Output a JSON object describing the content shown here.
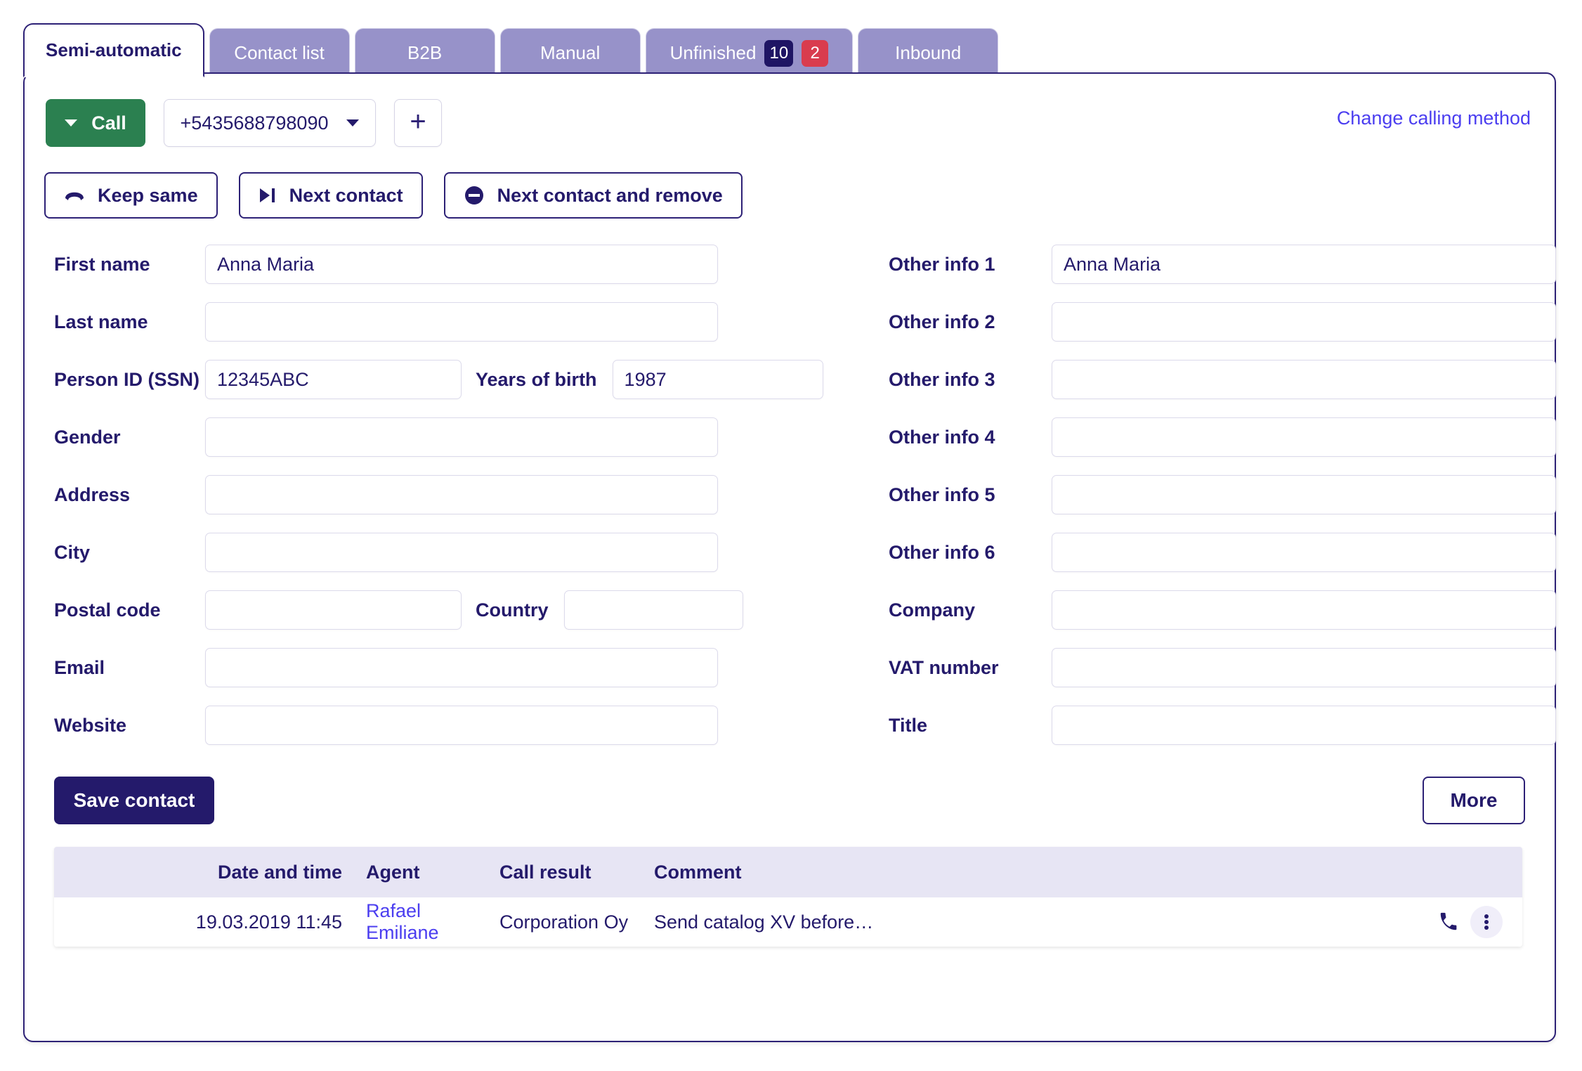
{
  "tabs": [
    {
      "label": "Semi-automatic",
      "active": true,
      "badges": []
    },
    {
      "label": "Contact list",
      "active": false,
      "badges": []
    },
    {
      "label": "B2B",
      "active": false,
      "badges": []
    },
    {
      "label": "Manual",
      "active": false,
      "badges": []
    },
    {
      "label": "Unfinished",
      "active": false,
      "badges": [
        {
          "value": "10",
          "color": "navy"
        },
        {
          "value": "2",
          "color": "red"
        }
      ]
    },
    {
      "label": "Inbound",
      "active": false,
      "badges": []
    }
  ],
  "toolbar": {
    "call_label": "Call",
    "phone_number": "+5435688798090",
    "add_number_label": "+",
    "change_calling_method": "Change calling method",
    "keep_same_label": "Keep same",
    "next_contact_label": "Next contact",
    "next_contact_remove_label": "Next contact and remove"
  },
  "form": {
    "left": {
      "first_name_label": "First name",
      "first_name_value": "Anna Maria",
      "last_name_label": "Last name",
      "last_name_value": "",
      "person_id_label": "Person ID (SSN)",
      "person_id_value": "12345ABC",
      "years_of_birth_label": "Years of birth",
      "years_of_birth_value": "1987",
      "gender_label": "Gender",
      "gender_value": "",
      "address_label": "Address",
      "address_value": "",
      "city_label": "City",
      "city_value": "",
      "postal_code_label": "Postal code",
      "postal_code_value": "",
      "country_label": "Country",
      "country_value": "",
      "email_label": "Email",
      "email_value": "",
      "website_label": "Website",
      "website_value": ""
    },
    "right": {
      "other_info_1_label": "Other info 1",
      "other_info_1_value": "Anna Maria",
      "other_info_2_label": "Other info 2",
      "other_info_2_value": "",
      "other_info_3_label": "Other info 3",
      "other_info_3_value": "",
      "other_info_4_label": "Other info 4",
      "other_info_4_value": "",
      "other_info_5_label": "Other info 5",
      "other_info_5_value": "",
      "other_info_6_label": "Other info 6",
      "other_info_6_value": "",
      "company_label": "Company",
      "company_value": "",
      "vat_number_label": "VAT number",
      "vat_number_value": "",
      "title_label": "Title",
      "title_value": ""
    }
  },
  "actions": {
    "save_contact_label": "Save contact",
    "more_label": "More"
  },
  "call_table": {
    "headers": {
      "date_time": "Date and time",
      "agent": "Agent",
      "call_result": "Call result",
      "comment": "Comment"
    },
    "rows": [
      {
        "date_time": "19.03.2019 11:45",
        "agent": "Rafael Emiliane",
        "call_result": "Corporation Oy",
        "comment": "Send catalog XV before…"
      }
    ]
  },
  "colors": {
    "brand_navy": "#241a6b",
    "tab_inactive": "#9792c9",
    "call_green": "#2b8050",
    "link_blue": "#4b3ef0",
    "badge_red": "#d93c4e",
    "table_header": "#e7e5f4"
  }
}
